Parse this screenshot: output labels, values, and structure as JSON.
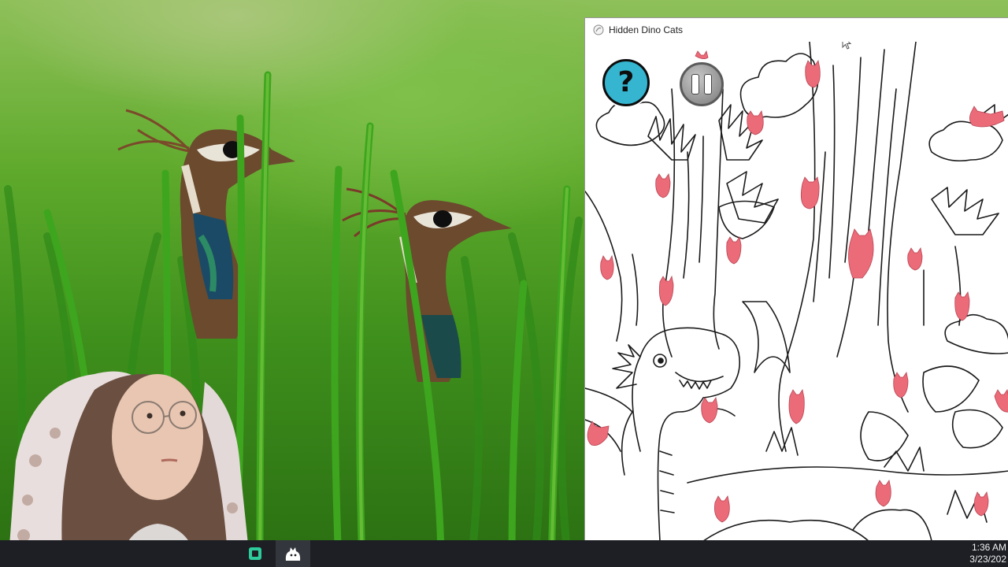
{
  "window": {
    "title": "Hidden Dino Cats",
    "buttons": {
      "help_label": "?",
      "help_icon": "question-mark-icon",
      "pause_icon": "pause-icon"
    }
  },
  "taskbar": {
    "apps": [
      {
        "name": "obs-app",
        "icon": "obs-icon"
      },
      {
        "name": "game-app",
        "icon": "dino-cat-icon"
      }
    ],
    "clock": {
      "time": "1:36 AM",
      "date": "3/23/202"
    }
  },
  "colors": {
    "cat_pink": "#ec6b78",
    "help_button": "#35b5d0",
    "taskbar": "#1d1f24",
    "grass_green": "#3e8f1c"
  }
}
